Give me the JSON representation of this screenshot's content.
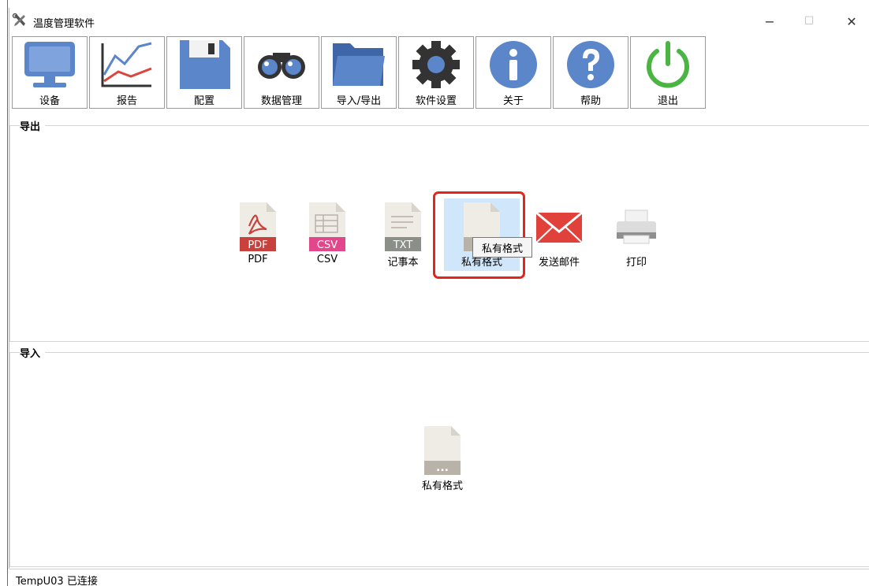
{
  "window": {
    "title": "温度管理软件",
    "min_glyph": "−",
    "max_glyph": "☐",
    "close_glyph": "✕"
  },
  "toolbar": {
    "items": [
      {
        "label": "设备",
        "icon": "monitor-icon"
      },
      {
        "label": "报告",
        "icon": "chart-icon"
      },
      {
        "label": "配置",
        "icon": "floppy-disk-icon"
      },
      {
        "label": "数据管理",
        "icon": "binoculars-icon"
      },
      {
        "label": "导入/导出",
        "icon": "folder-icon"
      },
      {
        "label": "软件设置",
        "icon": "gear-icon"
      },
      {
        "label": "关于",
        "icon": "info-icon"
      },
      {
        "label": "帮助",
        "icon": "help-icon"
      },
      {
        "label": "退出",
        "icon": "power-icon"
      }
    ]
  },
  "export": {
    "title": "导出",
    "items": [
      {
        "label": "PDF",
        "icon": "pdf-file-icon",
        "badge": "PDF"
      },
      {
        "label": "CSV",
        "icon": "csv-file-icon",
        "badge": "CSV"
      },
      {
        "label": "记事本",
        "icon": "txt-file-icon",
        "badge": "TXT"
      },
      {
        "label": "私有格式",
        "icon": "private-file-icon",
        "badge": "..."
      },
      {
        "label": "发送邮件",
        "icon": "mail-icon"
      },
      {
        "label": "打印",
        "icon": "printer-icon"
      }
    ],
    "tooltip": "私有格式"
  },
  "import": {
    "title": "导入",
    "items": [
      {
        "label": "私有格式",
        "icon": "private-file-icon",
        "badge": "..."
      }
    ]
  },
  "status": {
    "text": "TempU03 已连接"
  },
  "colors": {
    "accent_blue": "#5b86c9",
    "highlight_red": "#e8231c",
    "pdf_red": "#c8413d",
    "csv_pink": "#e2478b",
    "txt_gray": "#8a9088",
    "power_green": "#4bb543"
  }
}
